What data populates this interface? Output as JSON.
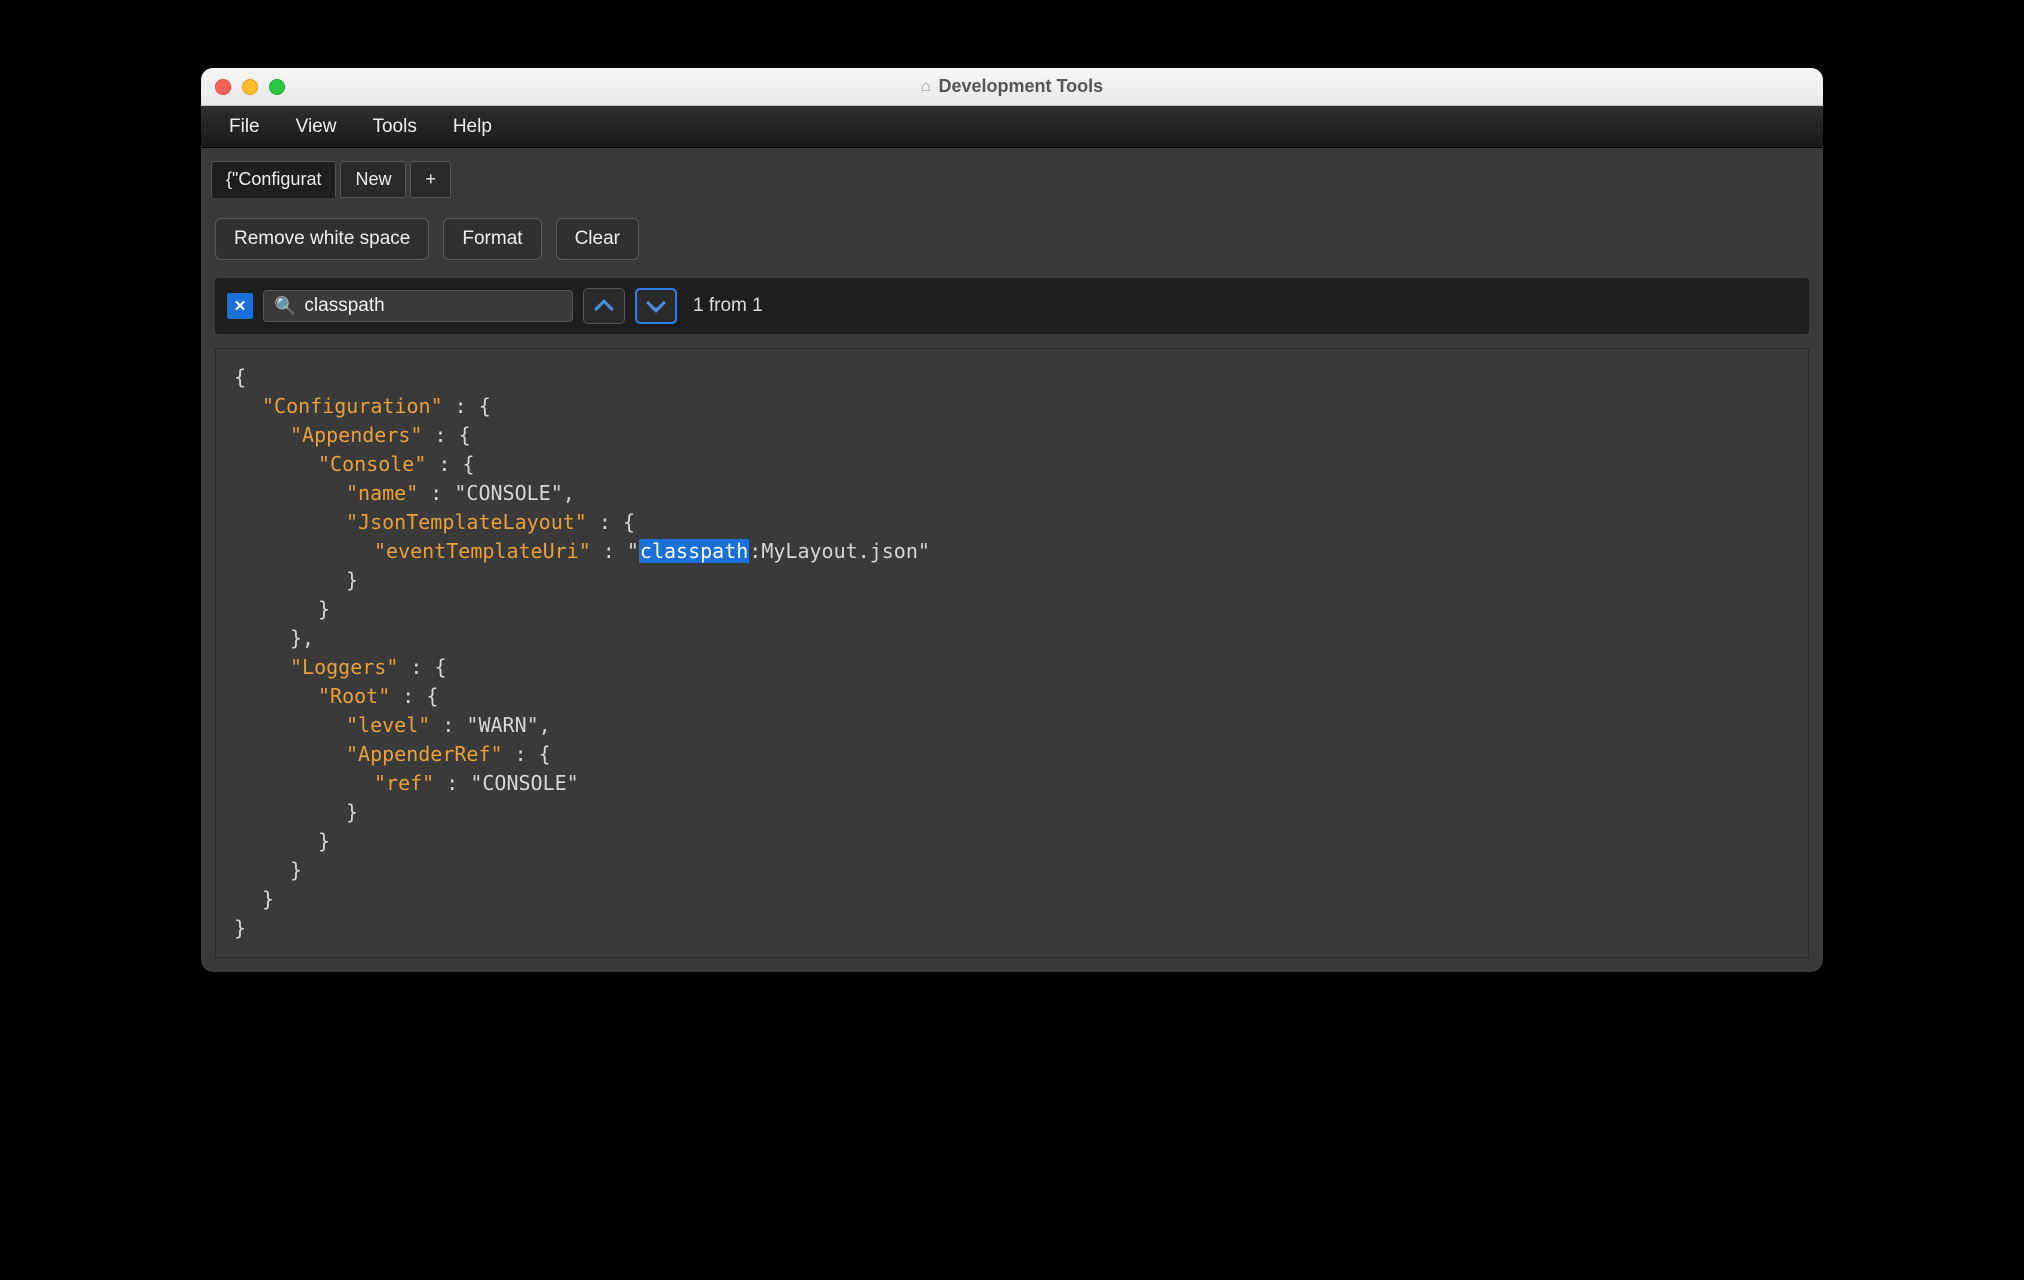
{
  "window": {
    "title": "Development Tools"
  },
  "menu": {
    "file": "File",
    "view": "View",
    "tools": "Tools",
    "help": "Help"
  },
  "tabs": {
    "t1": "{\"Configurat",
    "t2": "New",
    "plus": "+"
  },
  "toolbar": {
    "remove_ws": "Remove white space",
    "format": "Format",
    "clear": "Clear"
  },
  "search": {
    "query": "classpath",
    "close": "✕",
    "count": "1 from 1"
  },
  "code": {
    "l1": "{",
    "l2a": "\"Configuration\"",
    "l2b": " : {",
    "l3a": "\"Appenders\"",
    "l3b": " : {",
    "l4a": "\"Console\"",
    "l4b": " : {",
    "l5a": "\"name\"",
    "l5b": " : ",
    "l5c": "\"CONSOLE\"",
    "l5d": ",",
    "l6a": "\"JsonTemplateLayout\"",
    "l6b": " : {",
    "l7a": "\"eventTemplateUri\"",
    "l7b": " : ",
    "l7c": "\"",
    "l7hl": "classpath",
    "l7d": ":MyLayout.json\"",
    "l8": "}",
    "l9": "}",
    "l10": "},",
    "l11a": "\"Loggers\"",
    "l11b": " : {",
    "l12a": "\"Root\"",
    "l12b": " : {",
    "l13a": "\"level\"",
    "l13b": " : ",
    "l13c": "\"WARN\"",
    "l13d": ",",
    "l14a": "\"AppenderRef\"",
    "l14b": " : {",
    "l15a": "\"ref\"",
    "l15b": " : ",
    "l15c": "\"CONSOLE\"",
    "l16": "}",
    "l17": "}",
    "l18": "}",
    "l19": "}",
    "l20": "}"
  }
}
